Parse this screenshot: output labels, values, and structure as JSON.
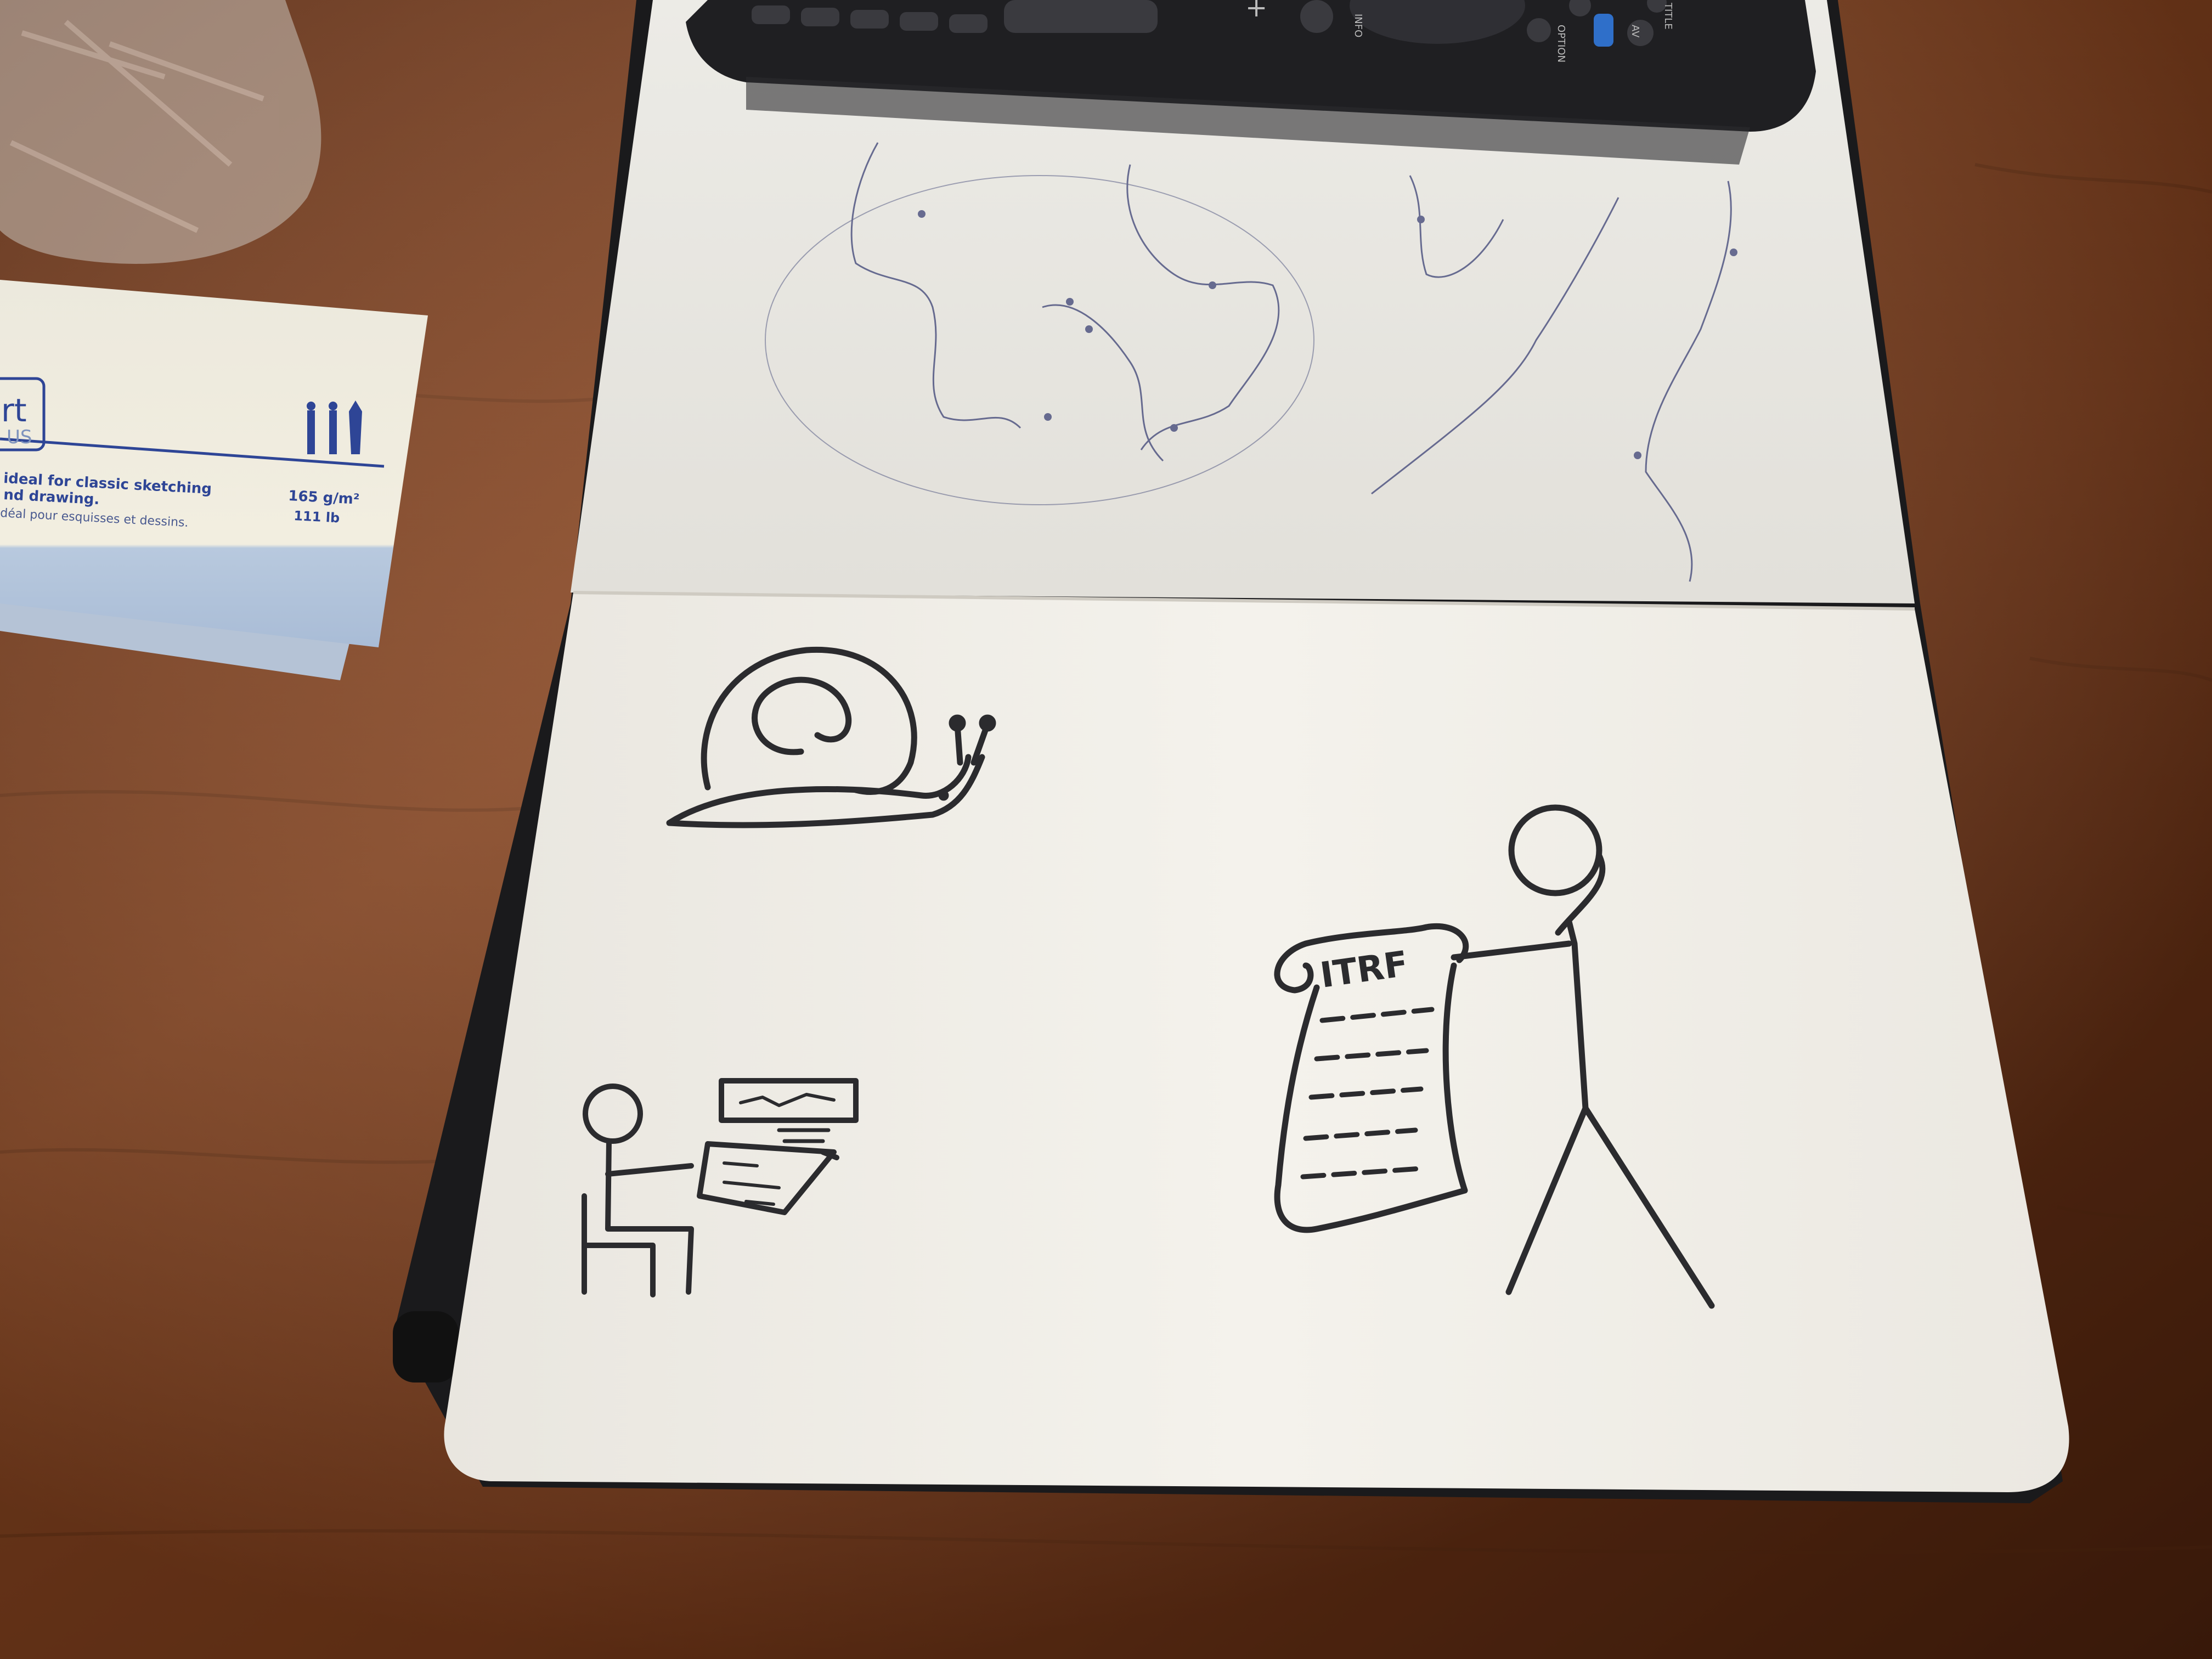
{
  "scene": {
    "description_free": true,
    "colors": {
      "wood_light": "#8a4722",
      "wood_dark": "#4d220e",
      "paper": "#f4f2ec",
      "paper_shadow": "#dcd8cf",
      "ink": "#2b2b2e",
      "map_ink": "#3c4275",
      "remote": "#1f1f22",
      "remote_blue_button": "#2f6fc9",
      "booklet_cream": "#f2eee0",
      "booklet_blue": "#b8c9de",
      "booklet_text_blue": "#2e4596"
    },
    "icons": {
      "booklet_logo": "pen-nib-icons",
      "remote": "tv-remote"
    }
  },
  "booklet": {
    "logo_word": "rt",
    "logo_sub": "US",
    "line1": "ideal for classic sketching",
    "line2": "nd drawing.",
    "line3": "déal pour esquisses et dessins.",
    "weight_metric": "165 g/m²",
    "weight_imperial": "111 lb"
  },
  "remote": {
    "label_info": "INFO",
    "label_option": "OPTION",
    "label_av": "AV",
    "label_title": "TITLE",
    "plus_glyph": "+"
  },
  "sketch": {
    "scroll_title": "ITRF"
  }
}
